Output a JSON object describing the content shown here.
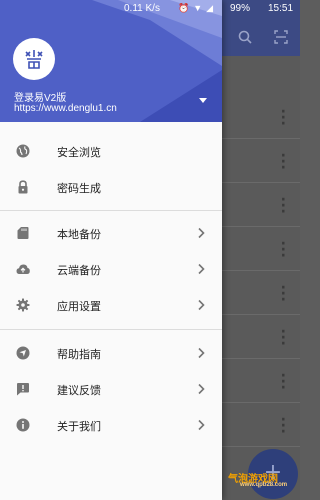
{
  "status_bar": {
    "network_speed": "0.11 K/s",
    "battery": "99%",
    "time": "15:51"
  },
  "drawer_header": {
    "app_name": "登录易V2版",
    "url": "https://www.denglu1.cn"
  },
  "menu": {
    "group1": [
      {
        "label": "安全浏览",
        "icon": "globe-icon"
      },
      {
        "label": "密码生成",
        "icon": "lock-icon"
      }
    ],
    "group2": [
      {
        "label": "本地备份",
        "icon": "sd-card-icon"
      },
      {
        "label": "云端备份",
        "icon": "cloud-upload-icon"
      },
      {
        "label": "应用设置",
        "icon": "gear-icon"
      }
    ],
    "group3": [
      {
        "label": "帮助指南",
        "icon": "navigation-icon"
      },
      {
        "label": "建议反馈",
        "icon": "feedback-icon"
      },
      {
        "label": "关于我们",
        "icon": "info-icon"
      }
    ]
  },
  "watermark": {
    "main": "气泡游戏网",
    "sub": "www.qpb28.com"
  },
  "colors": {
    "header": "#4f60c6",
    "toolbar": "#3c4a84",
    "icon": "#757575"
  }
}
